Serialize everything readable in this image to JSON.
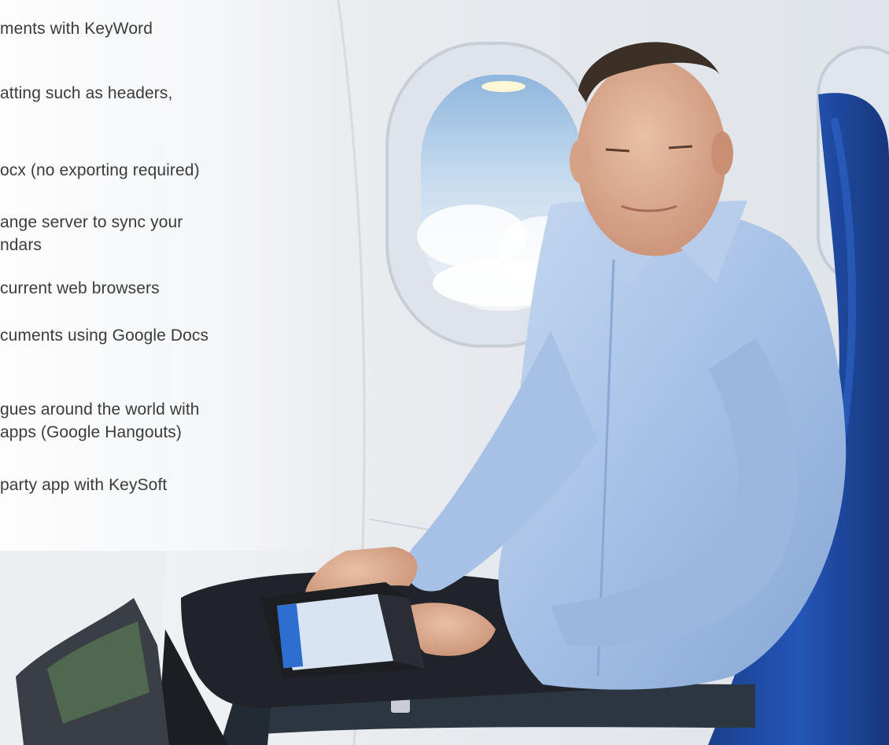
{
  "features": [
    {
      "lines": [
        "ments with KeyWord"
      ]
    },
    {
      "lines": [
        "atting such as headers,"
      ]
    },
    {
      "lines": [
        "ocx (no exporting required)"
      ]
    },
    {
      "lines": [
        "ange server to sync your",
        "ndars"
      ]
    },
    {
      "lines": [
        "current web browsers"
      ]
    },
    {
      "lines": [
        "cuments using Google Docs"
      ]
    },
    {
      "lines": [
        "gues around the world with",
        "apps (Google Hangouts)"
      ]
    },
    {
      "lines": [
        "party app with KeySoft"
      ]
    }
  ],
  "colors": {
    "text": "#3b3b3b",
    "seat_blue": "#1f4fa8",
    "shirt_blue": "#a9c4e8",
    "cabin_wall": "#e9ecef",
    "sky": "#b7d3ec"
  }
}
